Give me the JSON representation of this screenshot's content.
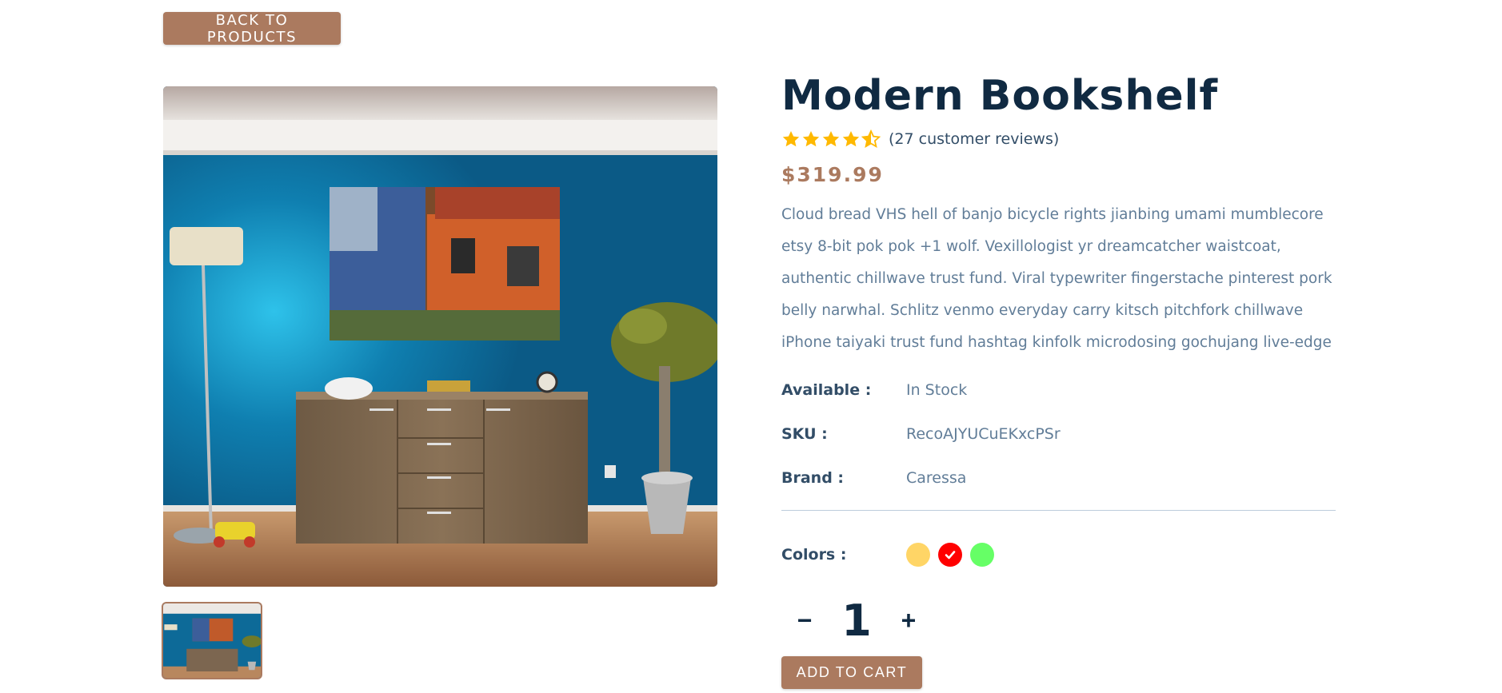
{
  "nav": {
    "back_label": "BACK TO PRODUCTS"
  },
  "product": {
    "title": "Modern Bookshelf",
    "rating": 4.5,
    "reviews_text": "(27 customer reviews)",
    "price": "$319.99",
    "description": "Cloud bread VHS hell of banjo bicycle rights jianbing umami mumblecore etsy 8-bit pok pok +1 wolf. Vexillologist yr dreamcatcher waistcoat, authentic chillwave trust fund. Viral typewriter fingerstache pinterest pork belly narwhal. Schlitz venmo everyday carry kitsch pitchfork chillwave iPhone taiyaki trust fund hashtag kinfolk microdosing gochujang live-edge",
    "info": [
      {
        "label": "Available :",
        "value": "In Stock"
      },
      {
        "label": "SKU :",
        "value": "RecoAJYUCuEKxcPSr"
      },
      {
        "label": "Brand :",
        "value": "Caressa"
      }
    ],
    "colors_label": "Colors :",
    "colors": [
      {
        "hex": "#ffb900",
        "selected": false
      },
      {
        "hex": "#ff0000",
        "selected": true
      },
      {
        "hex": "#00ff00",
        "selected": false
      }
    ],
    "quantity": "1",
    "qty_minus": "−",
    "qty_plus": "+",
    "add_to_cart_label": "ADD TO CART"
  },
  "icons": {
    "star": "star-icon",
    "half_star": "half-star-icon",
    "check": "check-icon"
  },
  "theme": {
    "accent": "#ab7a5f",
    "heading": "#102a42",
    "star": "#ffb900"
  }
}
